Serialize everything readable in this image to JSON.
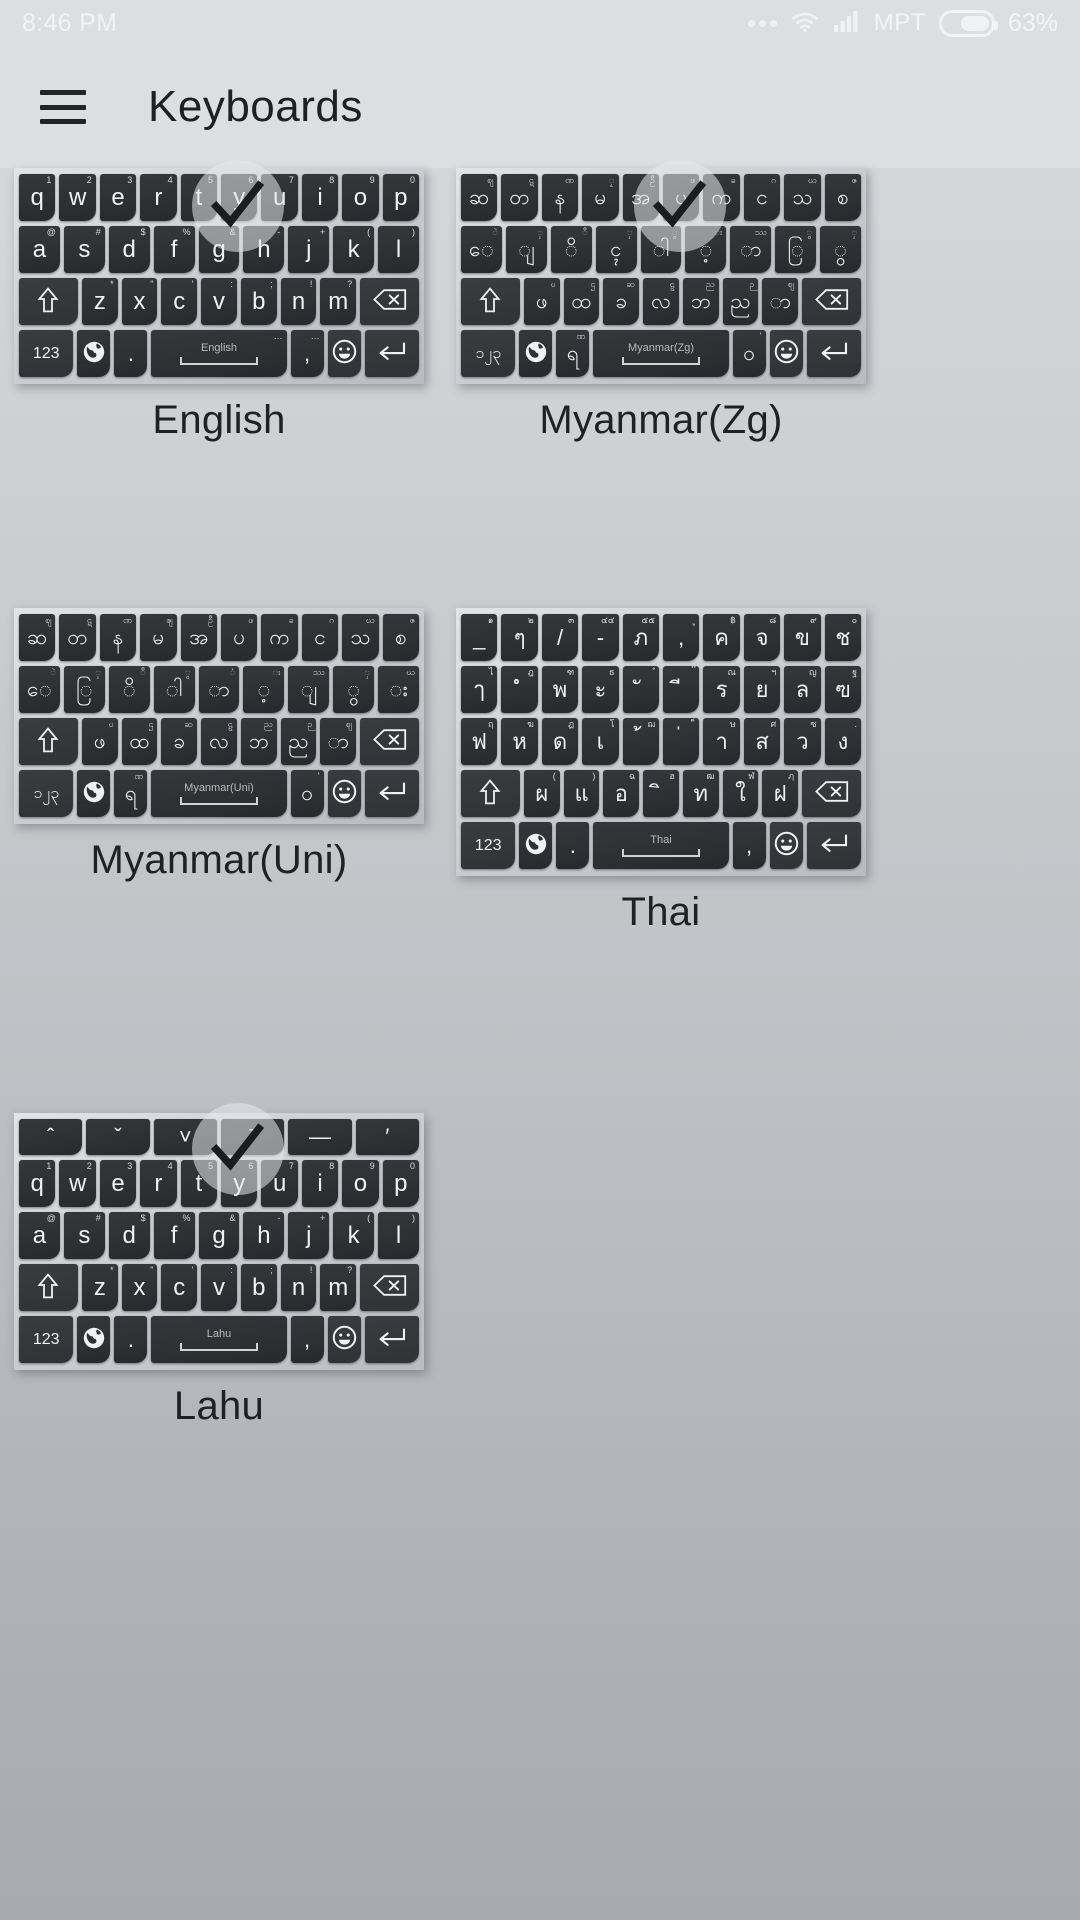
{
  "statusbar": {
    "time": "8:46 PM",
    "carrier": "MPT",
    "battery_percent": "63%",
    "battery_level": 63,
    "icons": [
      "more-dots-icon",
      "wifi-icon",
      "signal-icon",
      "battery-icon"
    ]
  },
  "appbar": {
    "menu_icon": "hamburger-menu-icon",
    "title": "Keyboards"
  },
  "keyboards": [
    {
      "name": "English",
      "label": "English",
      "selected": true,
      "space_label": "English",
      "rows": [
        [
          {
            "main": "q",
            "alt": "1"
          },
          {
            "main": "w",
            "alt": "2"
          },
          {
            "main": "e",
            "alt": "3"
          },
          {
            "main": "r",
            "alt": "4"
          },
          {
            "main": "t",
            "alt": "5"
          },
          {
            "main": "y",
            "alt": "6"
          },
          {
            "main": "u",
            "alt": "7"
          },
          {
            "main": "i",
            "alt": "8"
          },
          {
            "main": "o",
            "alt": "9"
          },
          {
            "main": "p",
            "alt": "0"
          }
        ],
        [
          {
            "main": "a",
            "alt": "@"
          },
          {
            "main": "s",
            "alt": "#"
          },
          {
            "main": "d",
            "alt": "$"
          },
          {
            "main": "f",
            "alt": "%"
          },
          {
            "main": "g",
            "alt": "&"
          },
          {
            "main": "h",
            "alt": "-"
          },
          {
            "main": "j",
            "alt": "+"
          },
          {
            "main": "k",
            "alt": "("
          },
          {
            "main": "l",
            "alt": ")"
          }
        ],
        [
          {
            "main": "⇧",
            "alt": "",
            "wide": true
          },
          {
            "main": "z",
            "alt": "*"
          },
          {
            "main": "x",
            "alt": "\""
          },
          {
            "main": "c",
            "alt": "'"
          },
          {
            "main": "v",
            "alt": ":"
          },
          {
            "main": "b",
            "alt": ";"
          },
          {
            "main": "n",
            "alt": "!"
          },
          {
            "main": "m",
            "alt": "?"
          },
          {
            "main": "⌫",
            "alt": "",
            "wide": true
          }
        ],
        [
          {
            "main": "123",
            "alt": "",
            "wide": true
          },
          {
            "main": "globe-icon",
            "alt": ""
          },
          {
            "main": ".",
            "alt": ""
          },
          {
            "main": "space",
            "alt": "…"
          },
          {
            "main": ",",
            "alt": "…"
          },
          {
            "main": "emoji-icon",
            "alt": ""
          },
          {
            "main": "⏎",
            "alt": "",
            "wide": true
          }
        ]
      ]
    },
    {
      "name": "Myanmar(Zg)",
      "label": "Myanmar(Zg)",
      "selected": true,
      "space_label": "Myanmar(Zg)",
      "rows": [
        [
          {
            "main": "ဆ",
            "alt": "ဈ"
          },
          {
            "main": "တ",
            "alt": "ဋ"
          },
          {
            "main": "န",
            "alt": "ဏ"
          },
          {
            "main": "မ",
            "alt": "ၟ"
          },
          {
            "main": "အ",
            "alt": "ဦ"
          },
          {
            "main": "ပ",
            "alt": "ဖ"
          },
          {
            "main": "က",
            "alt": "ခ"
          },
          {
            "main": "င",
            "alt": "ဂ"
          },
          {
            "main": "သ",
            "alt": "ဃ"
          },
          {
            "main": "စ",
            "alt": "ဇ"
          }
        ],
        [
          {
            "main": "ေ",
            "alt": "ဲ"
          },
          {
            "main": "ျ",
            "alt": "ှ"
          },
          {
            "main": "ိ",
            "alt": "ီ"
          },
          {
            "main": "ၚ",
            "alt": "ှ"
          },
          {
            "main": "ါ",
            "alt": "ွ"
          },
          {
            "main": "့",
            "alt": "း"
          },
          {
            "main": "ာ",
            "alt": "ဿ"
          },
          {
            "main": "ြ",
            "alt": "ွ"
          },
          {
            "main": "ွ",
            "alt": "ှ"
          }
        ],
        [
          {
            "main": "⇧",
            "alt": "",
            "wide": true
          },
          {
            "main": "ဖ",
            "alt": "ဎ"
          },
          {
            "main": "ထ",
            "alt": "ဌ"
          },
          {
            "main": "ခ",
            "alt": "ဆ"
          },
          {
            "main": "လ",
            "alt": "ဠ"
          },
          {
            "main": "ဘ",
            "alt": "ည"
          },
          {
            "main": "ည",
            "alt": "ဉ"
          },
          {
            "main": "ာ",
            "alt": "ဈ"
          },
          {
            "main": "⌫",
            "alt": "",
            "wide": true
          }
        ],
        [
          {
            "main": "၁၂၃",
            "alt": "",
            "wide": true
          },
          {
            "main": "globe-icon",
            "alt": ""
          },
          {
            "main": "ရ",
            "alt": "ဏ"
          },
          {
            "main": "space",
            "alt": ""
          },
          {
            "main": "ဝ",
            "alt": "'"
          },
          {
            "main": "emoji-icon",
            "alt": ""
          },
          {
            "main": "⏎",
            "alt": "",
            "wide": true
          }
        ]
      ]
    },
    {
      "name": "Myanmar(Uni)",
      "label": "Myanmar(Uni)",
      "selected": false,
      "space_label": "Myanmar(Uni)",
      "rows": [
        [
          {
            "main": "ဆ",
            "alt": "ဈ"
          },
          {
            "main": "တ",
            "alt": "ဋ"
          },
          {
            "main": "န",
            "alt": "ဏ"
          },
          {
            "main": "မ",
            "alt": "ၛ"
          },
          {
            "main": "အ",
            "alt": "ဦ"
          },
          {
            "main": "ပ",
            "alt": "ဖ"
          },
          {
            "main": "က",
            "alt": "ခ"
          },
          {
            "main": "င",
            "alt": "ဂ"
          },
          {
            "main": "သ",
            "alt": "ဃ"
          },
          {
            "main": "စ",
            "alt": "ဇ"
          }
        ],
        [
          {
            "main": "ေ",
            "alt": "ဲ"
          },
          {
            "main": "ြ",
            "alt": "ှ"
          },
          {
            "main": "ိ",
            "alt": "ီ"
          },
          {
            "main": "ါ",
            "alt": "ွ"
          },
          {
            "main": "ာ",
            "alt": "ံ"
          },
          {
            "main": "့",
            "alt": "း"
          },
          {
            "main": "ျ",
            "alt": "ဿ"
          },
          {
            "main": "ွ",
            "alt": "ှ"
          },
          {
            "main": "း",
            "alt": "ဃ"
          }
        ],
        [
          {
            "main": "⇧",
            "alt": "",
            "wide": true
          },
          {
            "main": "ဖ",
            "alt": "ဎ"
          },
          {
            "main": "ထ",
            "alt": "ဌ"
          },
          {
            "main": "ခ",
            "alt": "ဆ"
          },
          {
            "main": "လ",
            "alt": "ဠ"
          },
          {
            "main": "ဘ",
            "alt": "ည"
          },
          {
            "main": "ည",
            "alt": "ဉ"
          },
          {
            "main": "ာ",
            "alt": "ဈ"
          },
          {
            "main": "⌫",
            "alt": "",
            "wide": true
          }
        ],
        [
          {
            "main": "၁၂၃",
            "alt": "",
            "wide": true
          },
          {
            "main": "globe-icon",
            "alt": ""
          },
          {
            "main": "ရ",
            "alt": "ဏ"
          },
          {
            "main": "space",
            "alt": ""
          },
          {
            "main": "ဝ",
            "alt": "'"
          },
          {
            "main": "emoji-icon",
            "alt": ""
          },
          {
            "main": "⏎",
            "alt": "",
            "wide": true
          }
        ]
      ]
    },
    {
      "name": "Thai",
      "label": "Thai",
      "selected": false,
      "space_label": "Thai",
      "rows": [
        [
          {
            "main": "_",
            "alt": "๑"
          },
          {
            "main": "ๆ",
            "alt": "๒"
          },
          {
            "main": "/",
            "alt": "๓"
          },
          {
            "main": "-",
            "alt": "๔๔"
          },
          {
            "main": "ภ",
            "alt": "๕๕"
          },
          {
            "main": ",",
            "alt": "ู"
          },
          {
            "main": "ค",
            "alt": "฿"
          },
          {
            "main": "จ",
            "alt": "๘"
          },
          {
            "main": "ข",
            "alt": "๙"
          },
          {
            "main": "ช",
            "alt": "๐"
          }
        ],
        [
          {
            "main": "ๅ",
            "alt": "ไ"
          },
          {
            "main": "ํ",
            "alt": "ฎ"
          },
          {
            "main": "พ",
            "alt": "ฑ"
          },
          {
            "main": "ะ",
            "alt": "ธ"
          },
          {
            "main": "ั",
            "alt": "ํ"
          },
          {
            "main": "ี",
            "alt": "๊"
          },
          {
            "main": "ร",
            "alt": "ณ"
          },
          {
            "main": "ย",
            "alt": "ฯ"
          },
          {
            "main": "ล",
            "alt": "ญ"
          },
          {
            "main": "ฃ",
            "alt": "ฐ"
          }
        ],
        [
          {
            "main": "ฟ",
            "alt": "ฤ"
          },
          {
            "main": "ห",
            "alt": "ฆ"
          },
          {
            "main": "ด",
            "alt": "ฏ"
          },
          {
            "main": "เ",
            "alt": "โ"
          },
          {
            "main": "้",
            "alt": "ฌ"
          },
          {
            "main": "่",
            "alt": "็"
          },
          {
            "main": "า",
            "alt": "ษ"
          },
          {
            "main": "ส",
            "alt": "ศ"
          },
          {
            "main": "ว",
            "alt": "ซ"
          },
          {
            "main": "ง",
            "alt": "."
          }
        ],
        [
          {
            "main": "⇧",
            "alt": "",
            "wide": true
          },
          {
            "main": "ผ",
            "alt": "("
          },
          {
            "main": "แ",
            "alt": ")"
          },
          {
            "main": "อ",
            "alt": "ฉ"
          },
          {
            "main": "ิ",
            "alt": "ฮ"
          },
          {
            "main": "ท",
            "alt": "ฒ"
          },
          {
            "main": "ใ",
            "alt": "ฬ"
          },
          {
            "main": "ฝ",
            "alt": "ฦ"
          },
          {
            "main": "⌫",
            "alt": "",
            "wide": true
          }
        ],
        [
          {
            "main": "123",
            "alt": "",
            "wide": true
          },
          {
            "main": "globe-icon",
            "alt": ""
          },
          {
            "main": ".",
            "alt": ""
          },
          {
            "main": "space",
            "alt": ""
          },
          {
            "main": ",",
            "alt": ""
          },
          {
            "main": "emoji-icon",
            "alt": ""
          },
          {
            "main": "⏎",
            "alt": "",
            "wide": true
          }
        ]
      ]
    },
    {
      "name": "Lahu",
      "label": "Lahu",
      "selected": true,
      "space_label": "Lahu",
      "rows": [
        [
          {
            "main": "ˆ",
            "alt": ""
          },
          {
            "main": "ˇ",
            "alt": ""
          },
          {
            "main": "˅",
            "alt": ""
          },
          {
            "main": "ˉ",
            "alt": ""
          },
          {
            "main": "—",
            "alt": ""
          },
          {
            "main": "′",
            "alt": ""
          }
        ],
        [
          {
            "main": "q",
            "alt": "1"
          },
          {
            "main": "w",
            "alt": "2"
          },
          {
            "main": "e",
            "alt": "3"
          },
          {
            "main": "r",
            "alt": "4"
          },
          {
            "main": "t",
            "alt": "5"
          },
          {
            "main": "y",
            "alt": "6"
          },
          {
            "main": "u",
            "alt": "7"
          },
          {
            "main": "i",
            "alt": "8"
          },
          {
            "main": "o",
            "alt": "9"
          },
          {
            "main": "p",
            "alt": "0"
          }
        ],
        [
          {
            "main": "a",
            "alt": "@"
          },
          {
            "main": "s",
            "alt": "#"
          },
          {
            "main": "d",
            "alt": "$"
          },
          {
            "main": "f",
            "alt": "%"
          },
          {
            "main": "g",
            "alt": "&"
          },
          {
            "main": "h",
            "alt": "-"
          },
          {
            "main": "j",
            "alt": "+"
          },
          {
            "main": "k",
            "alt": "("
          },
          {
            "main": "l",
            "alt": ")"
          }
        ],
        [
          {
            "main": "⇧",
            "alt": "",
            "wide": true
          },
          {
            "main": "z",
            "alt": "*"
          },
          {
            "main": "x",
            "alt": "\""
          },
          {
            "main": "c",
            "alt": "'"
          },
          {
            "main": "v",
            "alt": ":"
          },
          {
            "main": "b",
            "alt": ";"
          },
          {
            "main": "n",
            "alt": "!"
          },
          {
            "main": "m",
            "alt": "?"
          },
          {
            "main": "⌫",
            "alt": "",
            "wide": true
          }
        ],
        [
          {
            "main": "123",
            "alt": "",
            "wide": true
          },
          {
            "main": "globe-icon",
            "alt": ""
          },
          {
            "main": ".",
            "alt": ""
          },
          {
            "main": "space",
            "alt": ""
          },
          {
            "main": ",",
            "alt": ""
          },
          {
            "main": "emoji-icon",
            "alt": ""
          },
          {
            "main": "⏎",
            "alt": "",
            "wide": true
          }
        ]
      ]
    }
  ],
  "colors": {
    "page_bg_top": "#dcdfe1",
    "page_bg_bottom": "#a7aab0",
    "key_dark": "#2e3033",
    "key_text": "#f0f1f2",
    "kb_frame": "#cfd2d5",
    "title_text": "#1e2021",
    "check_overlay": "#e8eaec"
  }
}
